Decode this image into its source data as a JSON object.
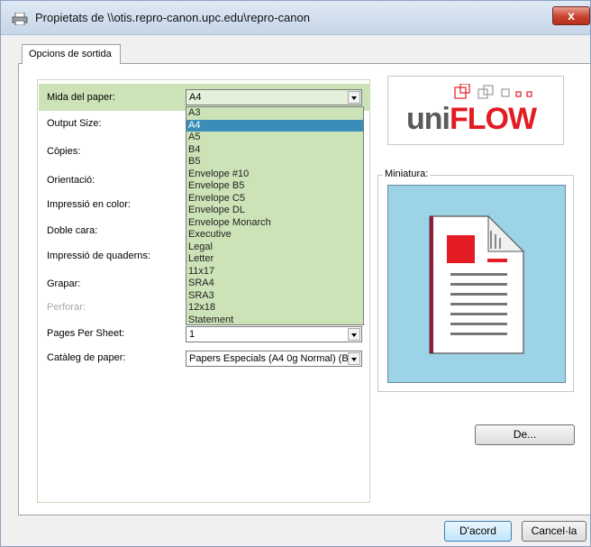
{
  "window": {
    "title": "Propietats de \\\\otis.repro-canon.upc.edu\\repro-canon",
    "close_glyph": "x"
  },
  "tab": {
    "label": "Opcions de sortida"
  },
  "settings": {
    "paper_size_label": "Mida del paper:",
    "paper_size_value": "A4",
    "output_size_label": "Output Size:",
    "copies_label": "Còpies:",
    "orientation_label": "Orientació:",
    "color_print_label": "Impressió en color:",
    "duplex_label": "Doble cara:",
    "booklet_label": "Impressió de quaderns:",
    "staple_label": "Grapar:",
    "punch_label": "Perforar:",
    "pages_per_sheet_label": "Pages Per Sheet:",
    "pages_per_sheet_value": "1",
    "paper_catalog_label": "Catàleg de paper:",
    "paper_catalog_value": "Papers Especials (A4 0g Normal) (Bl"
  },
  "paper_size_options": [
    "A3",
    "A4",
    "A5",
    "B4",
    "B5",
    "Envelope #10",
    "Envelope B5",
    "Envelope C5",
    "Envelope DL",
    "Envelope Monarch",
    "Executive",
    "Legal",
    "Letter",
    "11x17",
    "SRA4",
    "SRA3",
    "12x18",
    "Statement"
  ],
  "paper_size_selected_index": 1,
  "logo": {
    "part1": "uni",
    "part2": "FLOW"
  },
  "preview": {
    "legend": "Miniatura:"
  },
  "buttons": {
    "details": "De...",
    "ok": "D'acord",
    "cancel": "Cancel·la"
  },
  "colors": {
    "highlight": "#cce3b8",
    "selection": "#3a8db8",
    "preview_bg": "#9cd3e6",
    "logo_red": "#e31b23"
  }
}
